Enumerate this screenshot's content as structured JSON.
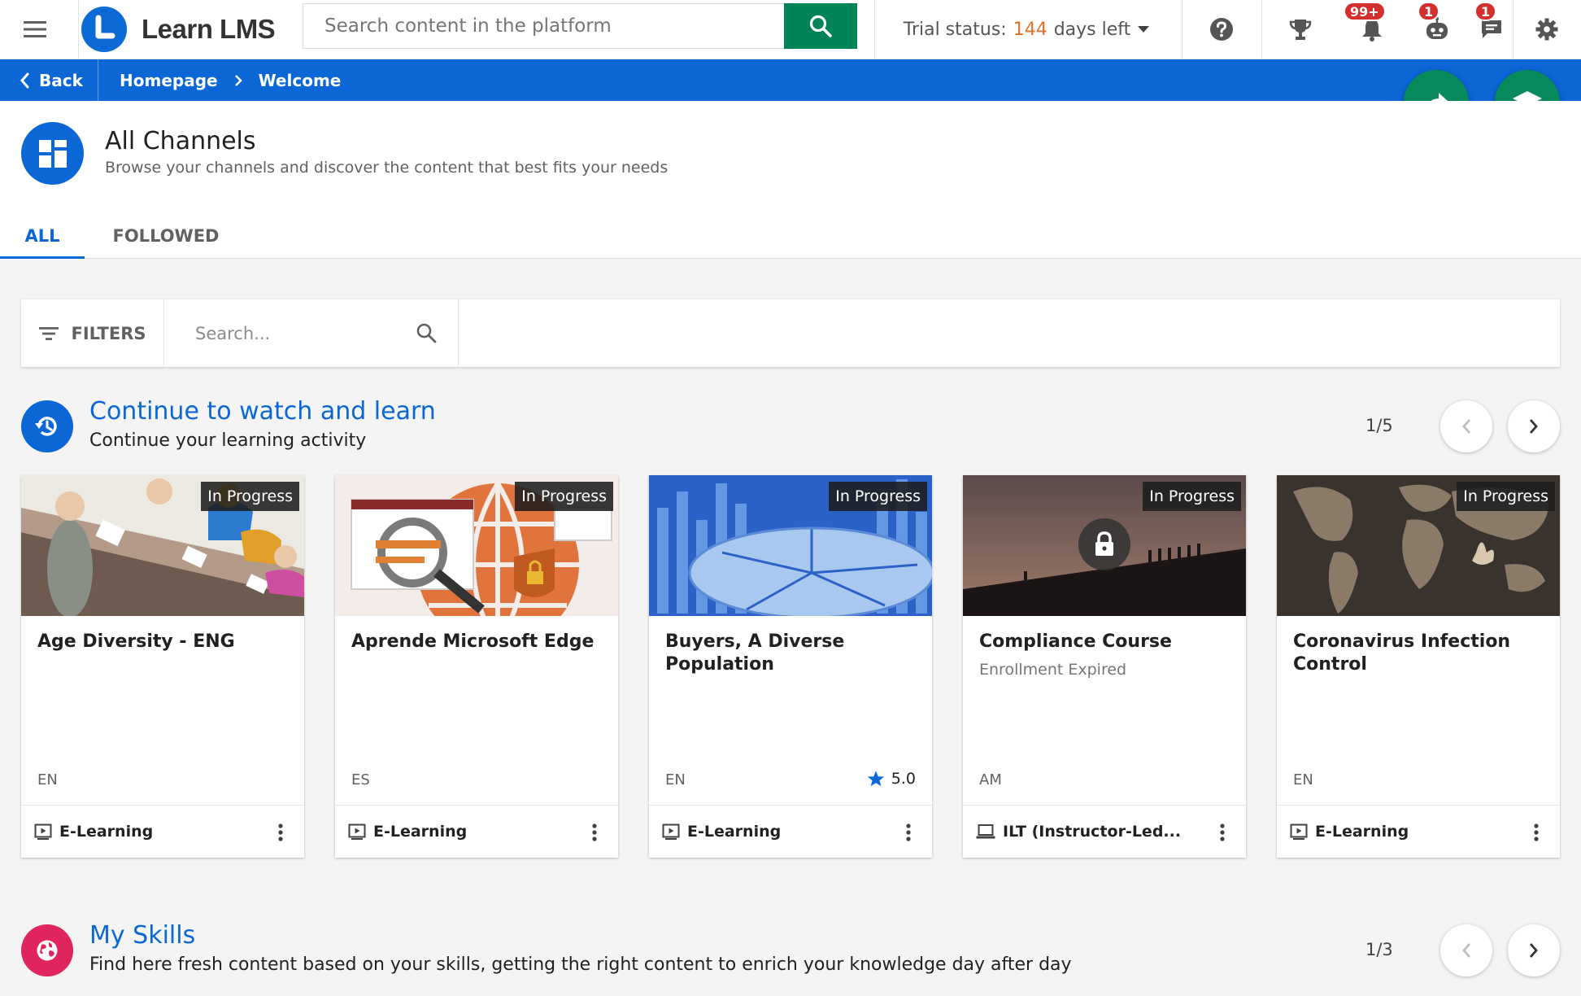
{
  "app": {
    "name": "Learn LMS"
  },
  "topbar": {
    "search_placeholder": "Search content in the platform",
    "trial_label": "Trial status:",
    "trial_days": "144",
    "trial_suffix": "days left",
    "badges": {
      "notifications": "99+",
      "bot": "1",
      "messages": "1"
    }
  },
  "breadcrumb": {
    "back": "Back",
    "items": [
      "Homepage",
      "Welcome"
    ]
  },
  "page": {
    "title": "All Channels",
    "subtitle": "Browse your channels and discover the content that best fits your needs",
    "tabs": [
      "ALL",
      "FOLLOWED"
    ]
  },
  "filters": {
    "label": "FILTERS",
    "search_placeholder": "Search..."
  },
  "sections": [
    {
      "title": "Continue to watch and learn",
      "subtitle": "Continue your learning activity",
      "pager": "1/5",
      "cards": [
        {
          "status": "In Progress",
          "title": "Age Diversity - ENG",
          "subtitle": "",
          "lang": "EN",
          "rating": "",
          "type": "E-Learning",
          "type_icon": "play-screen-icon"
        },
        {
          "status": "In Progress",
          "title": "Aprende Microsoft Edge",
          "subtitle": "",
          "lang": "ES",
          "rating": "",
          "type": "E-Learning",
          "type_icon": "play-screen-icon"
        },
        {
          "status": "In Progress",
          "title": "Buyers, A Diverse Population",
          "subtitle": "",
          "lang": "EN",
          "rating": "5.0",
          "type": "E-Learning",
          "type_icon": "play-screen-icon"
        },
        {
          "status": "In Progress",
          "title": "Compliance Course",
          "subtitle": "Enrollment Expired",
          "lang": "AM",
          "rating": "",
          "type": "ILT (Instructor-Led...",
          "type_icon": "laptop-icon"
        },
        {
          "status": "In Progress",
          "title": "Coronavirus Infection Control",
          "subtitle": "",
          "lang": "EN",
          "rating": "",
          "type": "E-Learning",
          "type_icon": "play-screen-icon"
        }
      ]
    },
    {
      "title": "My Skills",
      "subtitle": "Find here fresh content based on your skills, getting the right content to enrich your knowledge day after day",
      "pager": "1/3"
    }
  ],
  "colors": {
    "brand_blue": "#0b66d6",
    "brand_green": "#008456",
    "trial_orange": "#e0732b",
    "skills_pink": "#e0245e",
    "badge_red": "#d32f2f"
  }
}
